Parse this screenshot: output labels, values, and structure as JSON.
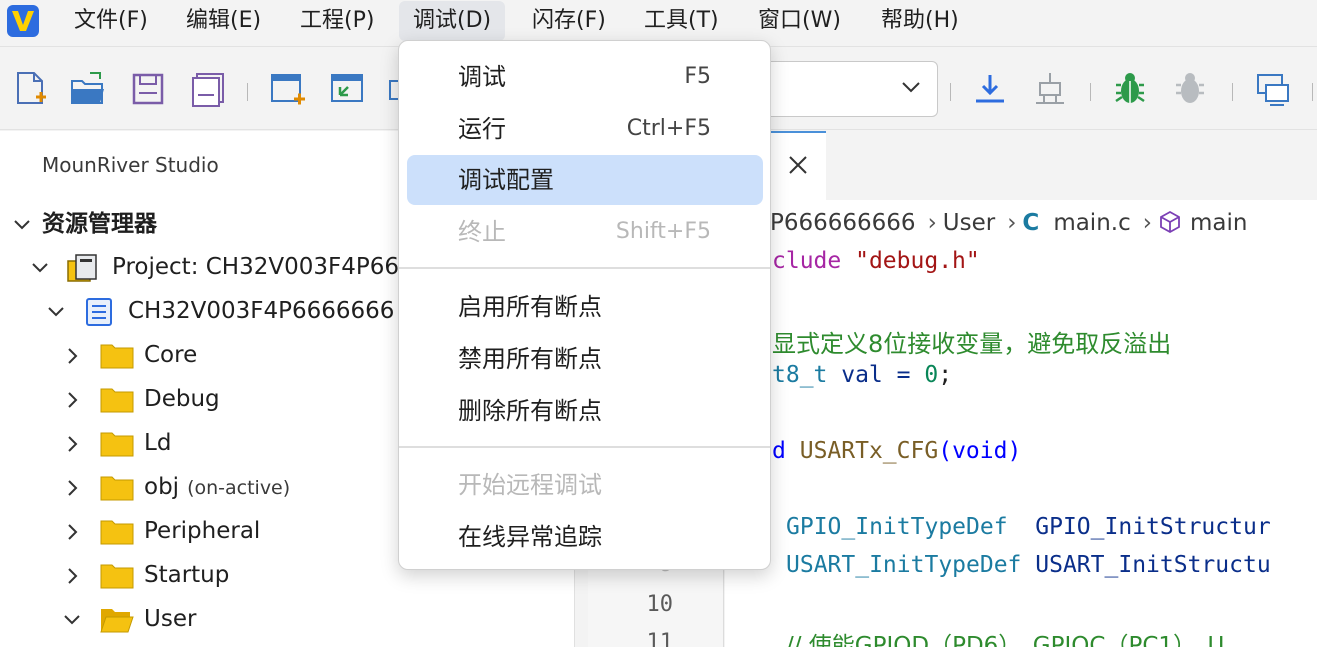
{
  "menubar": {
    "items": [
      {
        "label": "文件(F)"
      },
      {
        "label": "编辑(E)"
      },
      {
        "label": "工程(P)"
      },
      {
        "label": "调试(D)"
      },
      {
        "label": "闪存(F)"
      },
      {
        "label": "工具(T)"
      },
      {
        "label": "窗口(W)"
      },
      {
        "label": "帮助(H)"
      }
    ],
    "active_index": 3
  },
  "debug_menu": {
    "items": [
      {
        "label": "调试",
        "shortcut": "F5",
        "state": "normal"
      },
      {
        "label": "运行",
        "shortcut": "Ctrl+F5",
        "state": "normal"
      },
      {
        "label": "调试配置",
        "shortcut": "",
        "state": "highlighted"
      },
      {
        "label": "终止",
        "shortcut": "Shift+F5",
        "state": "disabled"
      },
      {
        "label": "启用所有断点",
        "shortcut": "",
        "state": "normal"
      },
      {
        "label": "禁用所有断点",
        "shortcut": "",
        "state": "normal"
      },
      {
        "label": "删除所有断点",
        "shortcut": "",
        "state": "normal"
      },
      {
        "label": "开始远程调试",
        "shortcut": "",
        "state": "disabled"
      },
      {
        "label": "在线异常追踪",
        "shortcut": "",
        "state": "normal"
      }
    ]
  },
  "explorer": {
    "panel_title": "MounRiver Studio",
    "section_title": "资源管理器",
    "project": "Project: CH32V003F4P66",
    "subproject": "CH32V003F4P6666666",
    "folders": [
      {
        "label": "Core",
        "note": "",
        "expanded": false
      },
      {
        "label": "Debug",
        "note": "",
        "expanded": false
      },
      {
        "label": "Ld",
        "note": "",
        "expanded": false
      },
      {
        "label": "obj",
        "note": "(on-active)",
        "expanded": false
      },
      {
        "label": "Peripheral",
        "note": "",
        "expanded": false
      },
      {
        "label": "Startup",
        "note": "",
        "expanded": false
      },
      {
        "label": "User",
        "note": "",
        "expanded": true
      }
    ]
  },
  "breadcrumb": {
    "project": "P666666666",
    "folder": "User",
    "file_icon_letter": "C",
    "file": "main.c",
    "symbol": "main"
  },
  "gutter": {
    "line_numbers": [
      "9",
      "10",
      "11"
    ]
  },
  "code": {
    "line1_kw": "clude",
    "line1_str": "\"debug.h\"",
    "line2_comment": "显式定义8位接收变量，避免取反溢出",
    "line3_type": "t8_t",
    "line3_rest": " val = ",
    "line3_num": "0",
    "line3_end": ";",
    "line4_kw": "d",
    "line4_fn": "USARTx_CFG",
    "line4_paren_open": "(",
    "line4_void": "void",
    "line4_paren_close": ")",
    "line5_type": "GPIO_InitTypeDef",
    "line5_var": "GPIO_InitStructur",
    "line6_type": "USART_InitTypeDef",
    "line6_var": "USART_InitStructu",
    "line7_comment": "// 使能GPIOD（PD6）、GPIOC（PC1）、U"
  },
  "colors": {
    "accent": "#4a90d9",
    "highlight": "#cce0fb",
    "folder": "#f5c211"
  }
}
